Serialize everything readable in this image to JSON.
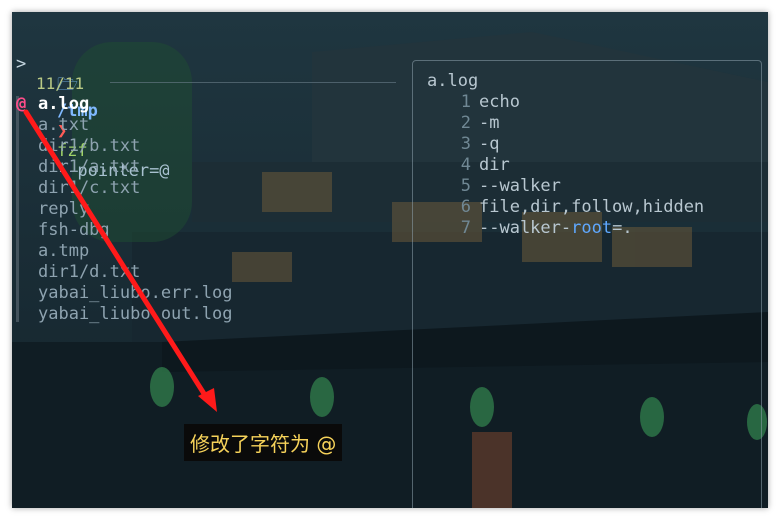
{
  "prompt": {
    "apple_icon": "apple-icon",
    "folder_icon": "folder-icon",
    "path": "/tmp",
    "chevron": "❯",
    "command": "fzf",
    "argument": "--pointer=@"
  },
  "query": ">",
  "counter": "11/11",
  "pointer": "@",
  "items": [
    "a.log",
    "a.txt",
    "dir1/b.txt",
    "dir1/a.txt",
    "dir1/c.txt",
    "reply",
    "fsh-dbg",
    "a.tmp",
    "dir1/d.txt",
    "yabai_liubo.err.log",
    "yabai_liubo.out.log"
  ],
  "preview": {
    "title": "a.log",
    "lines": [
      {
        "num": "1",
        "text": "echo",
        "kw": ""
      },
      {
        "num": "2",
        "text": "-m",
        "kw": ""
      },
      {
        "num": "3",
        "text": "-q",
        "kw": ""
      },
      {
        "num": "4",
        "text": "dir",
        "kw": ""
      },
      {
        "num": "5",
        "text": "--walker",
        "kw": ""
      },
      {
        "num": "6",
        "text": "file,dir,follow,hidden",
        "kw": ""
      },
      {
        "num": "7",
        "text": "--walker-",
        "kw": "root",
        "after": "=."
      }
    ]
  },
  "annotation": {
    "caption": "修改了字符为 @",
    "arrow_color": "#ff1a1a"
  }
}
